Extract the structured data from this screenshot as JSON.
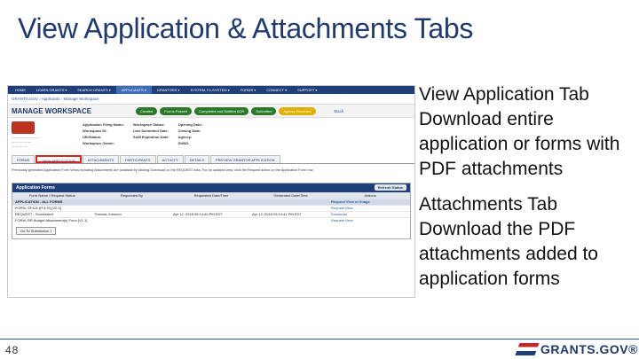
{
  "slide": {
    "title": "View Application & Attachments Tabs",
    "page_number": "48",
    "brand": "GRANTS.GOV®"
  },
  "screenshot": {
    "nav": [
      "HOME",
      "LEARN GRANTS ▾",
      "SEARCH GRANTS ▾",
      "APPLICANTS ▾",
      "GRANTORS ▾",
      "SYSTEM-TO-SYSTEM ▾",
      "FORMS ▾",
      "CONNECT ▾",
      "SUPPORT ▾"
    ],
    "breadcrumb": "GRANTS.GOV  ›  Applicants  ›  Manage Workspace",
    "workspace_title": "MANAGE WORKSPACE",
    "steps": [
      "Created",
      "Forms Passed",
      "Completed and Notified AOR",
      "Submitted",
      "Agency Received"
    ],
    "back_link": "‹Back",
    "details_left": [
      "Application Filing Name:",
      "Workspace ID:",
      "UEI/Status:",
      "Workspace Owner:"
    ],
    "details_right": [
      "Workspace Status:",
      "Last Submitted Date:",
      "SAM Expiration Date:"
    ],
    "dates": [
      "Opening Date:",
      "Closing Date:",
      "Agency:",
      "DUNS:"
    ],
    "tabs": [
      "FORMS",
      "VIEW APPLICATION",
      "ATTACHMENTS",
      "PARTICIPANTS",
      "ACTIVITY",
      "DETAILS",
      "PREVIEW GRANTOR APPLICATION"
    ],
    "info_text": "Previously generated Application Form Views including Attachments are available by clicking Download on the REQUEST links. For an updated view, click the Request action on the Application Form row.",
    "grid_title": "Application Forms",
    "refresh_label": "Refresh Status",
    "columns": [
      "Form Name / Request Status",
      "Requested By",
      "Requested Date/Time",
      "Generated Date/Time",
      "Actions"
    ],
    "rows": [
      {
        "c1": "APPLICATION - ALL FORMS",
        "c2": "",
        "c3": "",
        "c4": "",
        "c5": "Request View or Image",
        "band": true
      },
      {
        "c1": "FORM: SF424 (R & R) [V2.0]",
        "c2": "",
        "c3": "",
        "c4": "",
        "c5": "Request View",
        "band": false
      },
      {
        "c1": "REQUEST - Succeeded",
        "c2": "Thomas Johnson",
        "c3": "Apr 12, 2018 05:14:40 PM EDT",
        "c4": "Apr 12, 2018 05:14:41 PM EDT",
        "c5": "Download",
        "band": false
      },
      {
        "c1": "FORM: RR Budget Attachment(s) Form [V1.1]",
        "c2": "",
        "c3": "",
        "c4": "",
        "c5": "Request View",
        "band": false
      }
    ],
    "go_button": "Go To Submission ⟩"
  },
  "callouts": [
    {
      "heading": "View Application Tab",
      "body": "Download entire application or forms with PDF attachments"
    },
    {
      "heading": "Attachments Tab",
      "body": "Download the PDF attachments added to application forms"
    }
  ]
}
